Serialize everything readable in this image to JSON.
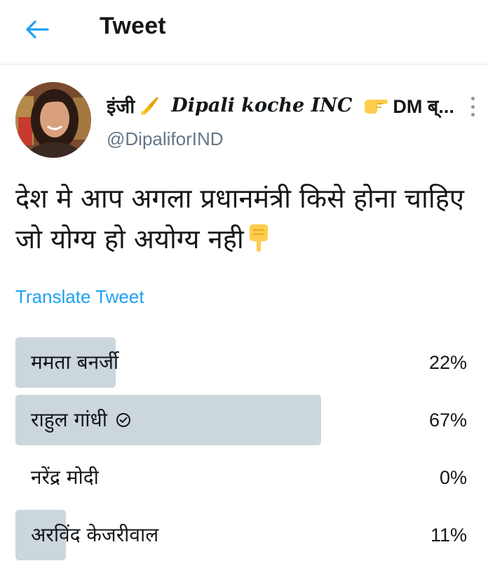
{
  "header": {
    "title": "Tweet",
    "back_icon": "arrow-left-icon",
    "accent_color": "#1da1f2"
  },
  "author": {
    "name_prefix": "इंजी",
    "name_main": "Dipali koche INC",
    "name_suffix": "DM ब्...",
    "handle": "@DipaliforIND",
    "emojis": [
      "writing-hand-emoji",
      "pointing-right-emoji"
    ]
  },
  "tweet": {
    "text": "देश मे आप अगला प्रधानमंत्री किसे होना चाहिए जो योग्य हो अयोग्य नही",
    "trailing_emoji": "pointing-down-emoji",
    "translate_label": "Translate Tweet"
  },
  "poll": {
    "bar_color": "#ccd6dd",
    "options": [
      {
        "label": "ममता बनर्जी",
        "percent_label": "22%",
        "fraction": 0.22,
        "selected": false
      },
      {
        "label": "राहुल गांधी",
        "percent_label": "67%",
        "fraction": 0.67,
        "selected": true
      },
      {
        "label": "नरेंद्र मोदी",
        "percent_label": "0%",
        "fraction": 0.0,
        "selected": false
      },
      {
        "label": "अरविंद केजरीवाल",
        "percent_label": "11%",
        "fraction": 0.11,
        "selected": false
      }
    ]
  }
}
